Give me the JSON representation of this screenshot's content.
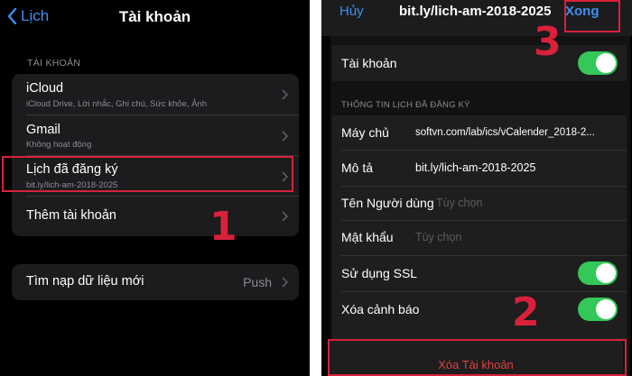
{
  "left": {
    "back_label": "Lịch",
    "title": "Tài khoản",
    "section_header": "TÀI KHOẢN",
    "accounts": [
      {
        "title": "iCloud",
        "subtitle": "iCloud Drive, Lời nhắc, Ghi chú, Sức khỏe, Ảnh"
      },
      {
        "title": "Gmail",
        "subtitle": "Không hoạt động"
      },
      {
        "title": "Lịch đã đăng ký",
        "subtitle": "bit.ly/lich-am-2018-2025"
      },
      {
        "title": "Thêm tài khoản",
        "subtitle": ""
      }
    ],
    "fetch": {
      "label": "Tìm nạp dữ liệu mới",
      "value": "Push"
    },
    "step_label": "1"
  },
  "right": {
    "cancel_label": "Hủy",
    "title": "bit.ly/lich-am-2018-2025",
    "done_label": "Xong",
    "account_toggle_label": "Tài khoản",
    "account_toggle_on": true,
    "section_header": "THÔNG TIN LỊCH ĐÃ ĐĂNG KÝ",
    "fields": [
      {
        "label": "Máy chủ",
        "value": "softvn.com/lab/ics/vCalender_2018-2...",
        "placeholder": ""
      },
      {
        "label": "Mô tả",
        "value": "bit.ly/lich-am-2018-2025",
        "placeholder": ""
      },
      {
        "label": "Tên Người dùng",
        "value": "",
        "placeholder": "Tùy chọn"
      },
      {
        "label": "Mật khẩu",
        "value": "",
        "placeholder": "Tùy chọn"
      }
    ],
    "ssl_label": "Sử dụng SSL",
    "ssl_on": true,
    "alert_label": "Xóa cảnh báo",
    "alert_on": true,
    "delete_label": "Xóa Tài khoản",
    "step_delete": "2",
    "step_done": "3"
  },
  "colors": {
    "accent_blue": "#3f8ff0",
    "toggle_green": "#34c759",
    "destructive_red": "#e0413a",
    "highlight_red": "#d8213a"
  }
}
